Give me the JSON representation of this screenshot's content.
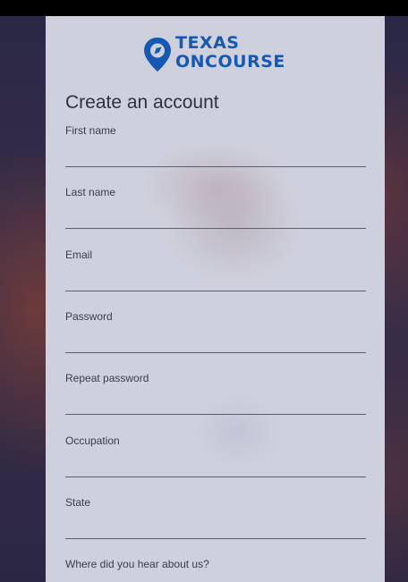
{
  "brand": {
    "line1": "TEXAS",
    "line2": "ONCOURSE",
    "color": "#1559b3"
  },
  "form": {
    "title": "Create an account",
    "fields": [
      {
        "label": "First name",
        "value": ""
      },
      {
        "label": "Last name",
        "value": ""
      },
      {
        "label": "Email",
        "value": ""
      },
      {
        "label": "Password",
        "value": ""
      },
      {
        "label": "Repeat password",
        "value": ""
      },
      {
        "label": "Occupation",
        "value": ""
      },
      {
        "label": "State",
        "value": ""
      },
      {
        "label": "Where did you hear about us?",
        "value": ""
      }
    ]
  },
  "icons": {
    "logo": "location-pin-icon"
  }
}
